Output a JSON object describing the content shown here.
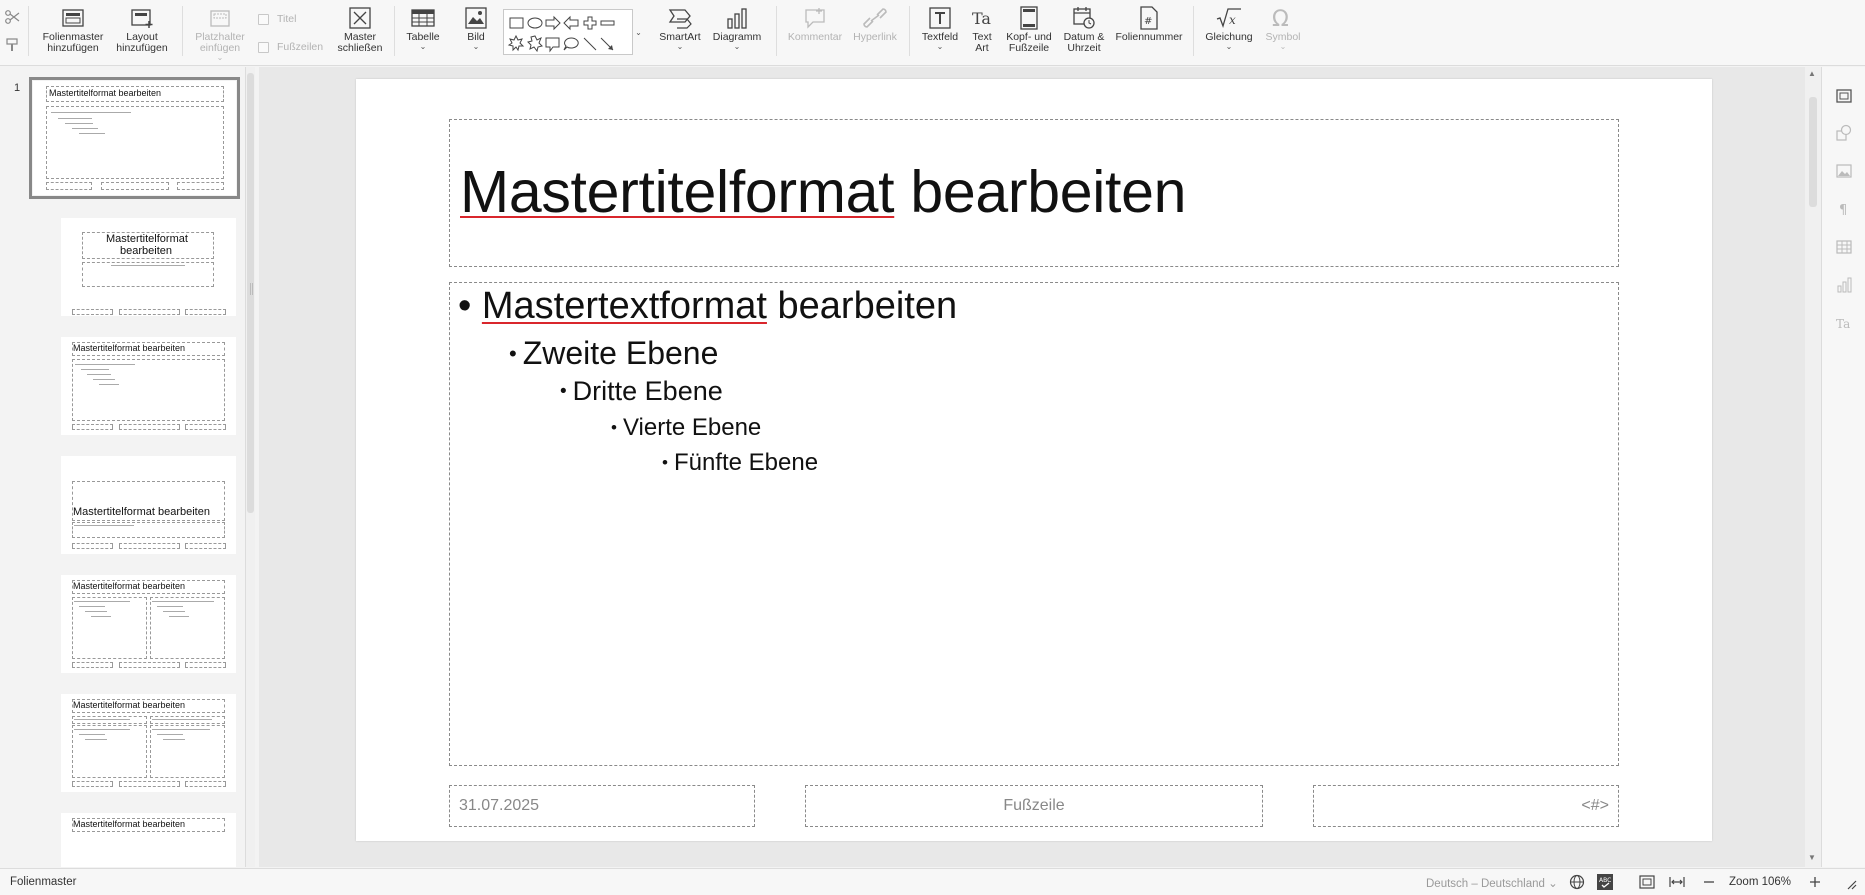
{
  "toolbar": {
    "folienmaster_hinzufuegen": [
      "Folienmaster",
      "hinzufügen"
    ],
    "layout_hinzufuegen": [
      "Layout",
      "hinzufügen"
    ],
    "platzhalter_einfuegen": [
      "Platzhalter",
      "einfügen"
    ],
    "titel": "Titel",
    "fusszeilen": "Fußzeilen",
    "master_schliessen": [
      "Master",
      "schließen"
    ],
    "tabelle": "Tabelle",
    "bild": "Bild",
    "smartart": "SmartArt",
    "diagramm": "Diagramm",
    "kommentar": "Kommentar",
    "hyperlink": "Hyperlink",
    "textfeld": "Textfeld",
    "text_art": [
      "Text",
      "Art"
    ],
    "kopf_fusszeile": [
      "Kopf- und",
      "Fußzeile"
    ],
    "datum_uhrzeit": [
      "Datum &",
      "Uhrzeit"
    ],
    "foliennummer": "Foliennummer",
    "gleichung": "Gleichung",
    "symbol": "Symbol"
  },
  "slides_panel": {
    "master_number": "1",
    "thumb_title": "Mastertitelformat bearbeiten",
    "thumb_title_split": [
      "Mastertitelformat",
      "bearbeiten"
    ]
  },
  "slide": {
    "title": [
      "Mastertitelformat",
      "bearbeiten"
    ],
    "levels": [
      {
        "bullet": "•",
        "text": [
          "Mastertextformat",
          "bearbeiten"
        ]
      },
      {
        "bullet": "•",
        "text": [
          "Zweite Ebene"
        ]
      },
      {
        "bullet": "•",
        "text": [
          "Dritte Ebene"
        ]
      },
      {
        "bullet": "•",
        "text": [
          "Vierte Ebene"
        ]
      },
      {
        "bullet": "•",
        "text": [
          "Fünfte Ebene"
        ]
      }
    ],
    "footer_date": "31.07.2025",
    "footer_text": "Fußzeile",
    "footer_number": "<#>"
  },
  "statusbar": {
    "mode": "Folienmaster",
    "language": "Deutsch – Deutschland",
    "zoom": "Zoom 106%"
  },
  "colors": {
    "accent": "#444444",
    "spell_error": "#d9262c",
    "placeholder_border": "#8a8a8a"
  }
}
